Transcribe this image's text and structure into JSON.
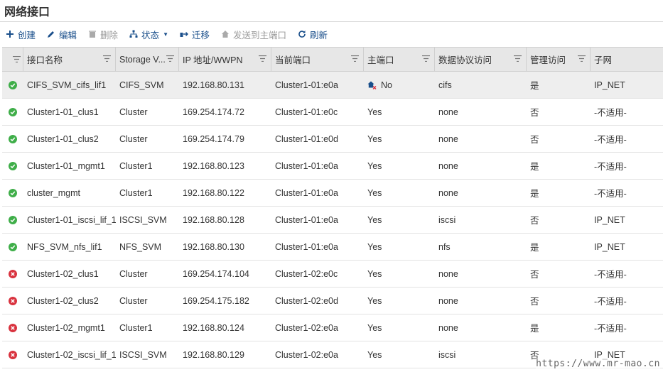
{
  "page": {
    "title": "网络接口"
  },
  "toolbar": {
    "create": "创建",
    "edit": "编辑",
    "delete": "删除",
    "status": "状态",
    "migrate": "迁移",
    "send_home": "发送到主端口",
    "refresh": "刷新"
  },
  "columns": [
    "",
    "接口名称",
    "Storage V...",
    "IP 地址/WWPN",
    "当前端口",
    "主端口",
    "数据协议访问",
    "管理访问",
    "子网"
  ],
  "rows": [
    {
      "status": "ok",
      "name": "CIFS_SVM_cifs_lif1",
      "svm": "CIFS_SVM",
      "ip": "192.168.80.131",
      "port": "Cluster1-01:e0a",
      "home": "No",
      "home_icon": true,
      "proto": "cifs",
      "mgmt": "是",
      "subnet": "IP_NET"
    },
    {
      "status": "ok",
      "name": "Cluster1-01_clus1",
      "svm": "Cluster",
      "ip": "169.254.174.72",
      "port": "Cluster1-01:e0c",
      "home": "Yes",
      "home_icon": false,
      "proto": "none",
      "mgmt": "否",
      "subnet": "-不适用-"
    },
    {
      "status": "ok",
      "name": "Cluster1-01_clus2",
      "svm": "Cluster",
      "ip": "169.254.174.79",
      "port": "Cluster1-01:e0d",
      "home": "Yes",
      "home_icon": false,
      "proto": "none",
      "mgmt": "否",
      "subnet": "-不适用-"
    },
    {
      "status": "ok",
      "name": "Cluster1-01_mgmt1",
      "svm": "Cluster1",
      "ip": "192.168.80.123",
      "port": "Cluster1-01:e0a",
      "home": "Yes",
      "home_icon": false,
      "proto": "none",
      "mgmt": "是",
      "subnet": "-不适用-"
    },
    {
      "status": "ok",
      "name": "cluster_mgmt",
      "svm": "Cluster1",
      "ip": "192.168.80.122",
      "port": "Cluster1-01:e0a",
      "home": "Yes",
      "home_icon": false,
      "proto": "none",
      "mgmt": "是",
      "subnet": "-不适用-"
    },
    {
      "status": "ok",
      "name": "Cluster1-01_iscsi_lif_1",
      "svm": "ISCSI_SVM",
      "ip": "192.168.80.128",
      "port": "Cluster1-01:e0a",
      "home": "Yes",
      "home_icon": false,
      "proto": "iscsi",
      "mgmt": "否",
      "subnet": "IP_NET"
    },
    {
      "status": "ok",
      "name": "NFS_SVM_nfs_lif1",
      "svm": "NFS_SVM",
      "ip": "192.168.80.130",
      "port": "Cluster1-01:e0a",
      "home": "Yes",
      "home_icon": false,
      "proto": "nfs",
      "mgmt": "是",
      "subnet": "IP_NET"
    },
    {
      "status": "err",
      "name": "Cluster1-02_clus1",
      "svm": "Cluster",
      "ip": "169.254.174.104",
      "port": "Cluster1-02:e0c",
      "home": "Yes",
      "home_icon": false,
      "proto": "none",
      "mgmt": "否",
      "subnet": "-不适用-"
    },
    {
      "status": "err",
      "name": "Cluster1-02_clus2",
      "svm": "Cluster",
      "ip": "169.254.175.182",
      "port": "Cluster1-02:e0d",
      "home": "Yes",
      "home_icon": false,
      "proto": "none",
      "mgmt": "否",
      "subnet": "-不适用-"
    },
    {
      "status": "err",
      "name": "Cluster1-02_mgmt1",
      "svm": "Cluster1",
      "ip": "192.168.80.124",
      "port": "Cluster1-02:e0a",
      "home": "Yes",
      "home_icon": false,
      "proto": "none",
      "mgmt": "是",
      "subnet": "-不适用-"
    },
    {
      "status": "err",
      "name": "Cluster1-02_iscsi_lif_1",
      "svm": "ISCSI_SVM",
      "ip": "192.168.80.129",
      "port": "Cluster1-02:e0a",
      "home": "Yes",
      "home_icon": false,
      "proto": "iscsi",
      "mgmt": "否",
      "subnet": "IP_NET"
    }
  ],
  "watermark": "https://www.mr-mao.cn",
  "colors": {
    "ok": "#3fae49",
    "err": "#d9333f",
    "link": "#1a4f8b"
  }
}
